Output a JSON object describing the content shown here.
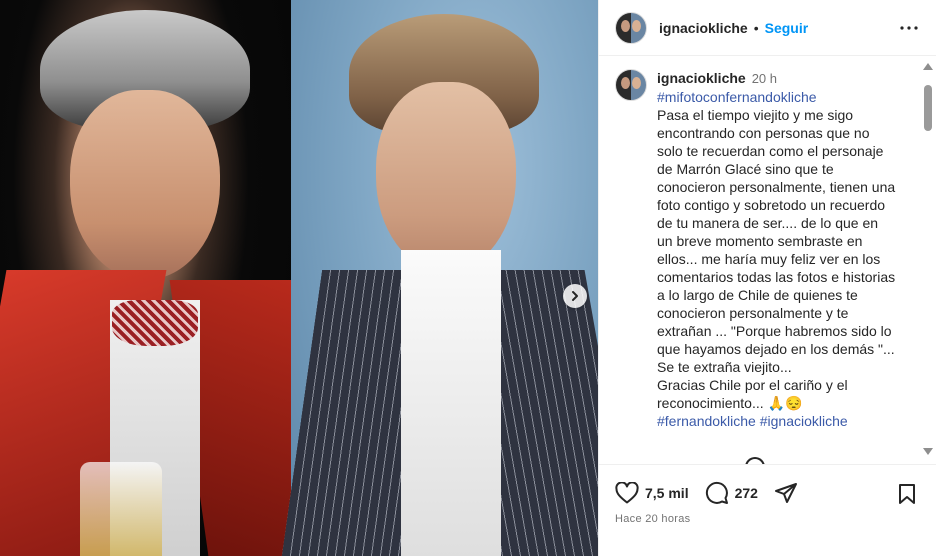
{
  "post": {
    "username": "ignaciokliche",
    "separator": "•",
    "follow_label": "Seguir",
    "caption": {
      "username": "ignaciokliche",
      "time": "20 h",
      "hashtag_top": "#mifotoconfernandokliche",
      "text": "Pasa el tiempo viejito y me sigo encontrando con personas que no solo te recuerdan como el personaje de Marrón Glacé sino que te conocieron personalmente, tienen una foto contigo y sobretodo un recuerdo de tu manera de ser.... de lo que en un breve momento sembraste en ellos... me haría muy feliz ver en los comentarios todas las fotos e historias a lo largo de Chile de quienes te conocieron  personalmente y te extrañan ... \"Porque habremos sido lo que hayamos dejado en los demás \"...\nSe te extraña viejito...\n Gracias Chile por el cariño y el reconocimiento...",
      "emojis": [
        "🙏",
        "😔"
      ],
      "hashtags_bottom": [
        "#fernandokliche",
        "#ignaciokliche"
      ]
    },
    "likes": "7,5 mil",
    "comments_count": "272",
    "posted_ago": "Hace 20 horas"
  },
  "icons": {
    "heart": "heart-icon",
    "comment": "comment-icon",
    "share": "share-icon",
    "save": "bookmark-icon",
    "more": "more-icon",
    "next": "chevron-right-icon"
  }
}
